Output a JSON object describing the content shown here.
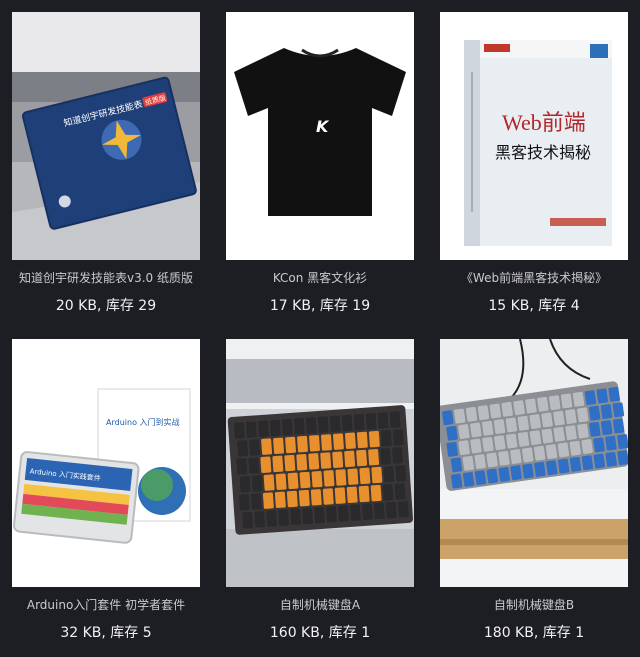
{
  "products": [
    {
      "title": "知道创宇研发技能表v3.0 纸质版",
      "size": "20 KB",
      "stock_label": "库存",
      "stock": "29",
      "image": "skill-table-booklet-image",
      "image_text": {
        "booklet_title": "知道创宇研发技能表",
        "badge": "纸质版"
      }
    },
    {
      "title": "KCon 黑客文化衫",
      "size": "17 KB",
      "stock_label": "库存",
      "stock": "19",
      "image": "black-tshirt-image",
      "image_text": {
        "logo": "K"
      }
    },
    {
      "title": "《Web前端黑客技术揭秘》",
      "size": "15 KB",
      "stock_label": "库存",
      "stock": "4",
      "image": "book-cover-image",
      "image_text": {
        "cover_title": "Web前端",
        "cover_subtitle": "黑客技术揭秘"
      }
    },
    {
      "title": "Arduino入门套件 初学者套件",
      "size": "32 KB",
      "stock_label": "库存",
      "stock": "5",
      "image": "arduino-kit-image",
      "image_text": {
        "book_title": "Arduino 入门到实战",
        "box_title": "Arduino 入门实践套件"
      }
    },
    {
      "title": "自制机械键盘A",
      "size": "160 KB",
      "stock_label": "库存",
      "stock": "1",
      "image": "keyboard-a-image"
    },
    {
      "title": "自制机械键盘B",
      "size": "180 KB",
      "stock_label": "库存",
      "stock": "1",
      "image": "keyboard-b-image"
    }
  ],
  "colors": {
    "background": "#1d1d24",
    "title_text": "#c9c9cf",
    "meta_text": "#f2f2f2",
    "thumb_bg": "#ffffff",
    "keycap_orange": "#e8902e",
    "keycap_blue": "#2f6fc6"
  }
}
